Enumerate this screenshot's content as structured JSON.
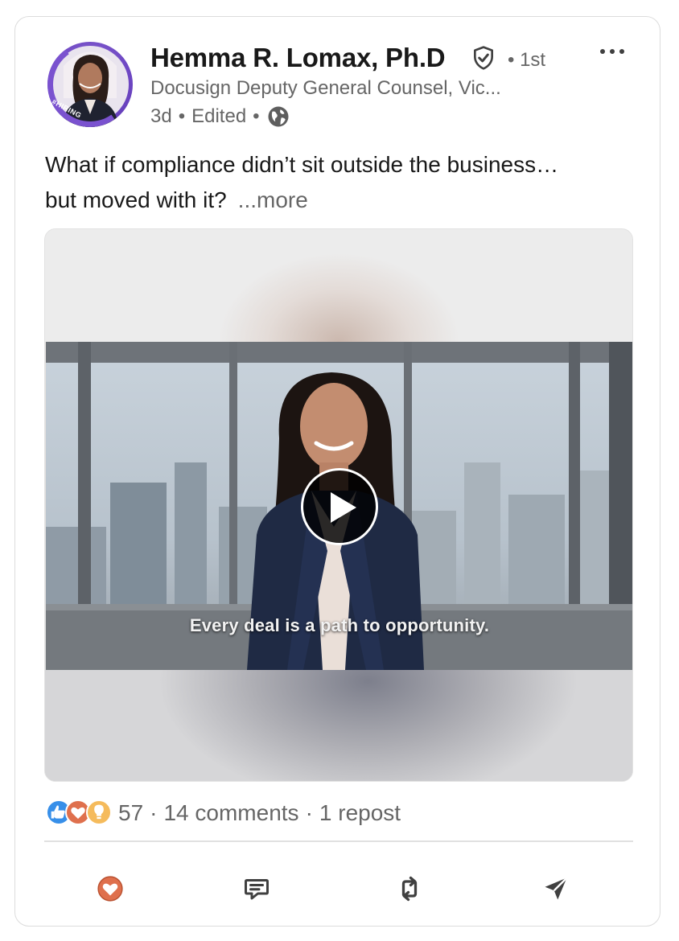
{
  "post": {
    "author": {
      "name": "Hemma R. Lomax, Ph.D",
      "degree": "• 1st",
      "headline": "Docusign Deputy General Counsel, Vic...",
      "avatar_badge": "#HIRING",
      "verified_icon": "verified-shield-icon"
    },
    "meta": {
      "time": "3d",
      "edited": "Edited",
      "separator": "•",
      "visibility_icon": "globe-icon"
    },
    "text": {
      "line1": "What if compliance didn’t sit outside the business…",
      "line2": "but moved with it?",
      "more": "...more"
    },
    "video": {
      "caption": "Every deal is a path to opportunity.",
      "play_icon": "play-icon"
    },
    "social": {
      "reactions_count": "57",
      "comments": "14 comments",
      "reposts": "1 repost",
      "separator": "·",
      "reaction_icons": [
        "like-icon",
        "love-icon",
        "insightful-icon"
      ]
    },
    "actions": [
      {
        "name": "react",
        "icon": "heart-icon"
      },
      {
        "name": "comment",
        "icon": "comment-icon"
      },
      {
        "name": "repost",
        "icon": "repost-icon"
      },
      {
        "name": "send",
        "icon": "send-icon"
      }
    ],
    "menu_icon": "more-horizontal-icon"
  },
  "colors": {
    "primary_text": "#191919",
    "secondary_text": "#666666",
    "avatar_ring": "#6f48c4",
    "love_reaction": "#df704d",
    "like_reaction": "#378fe9",
    "insightful_reaction": "#f5bb5c"
  }
}
